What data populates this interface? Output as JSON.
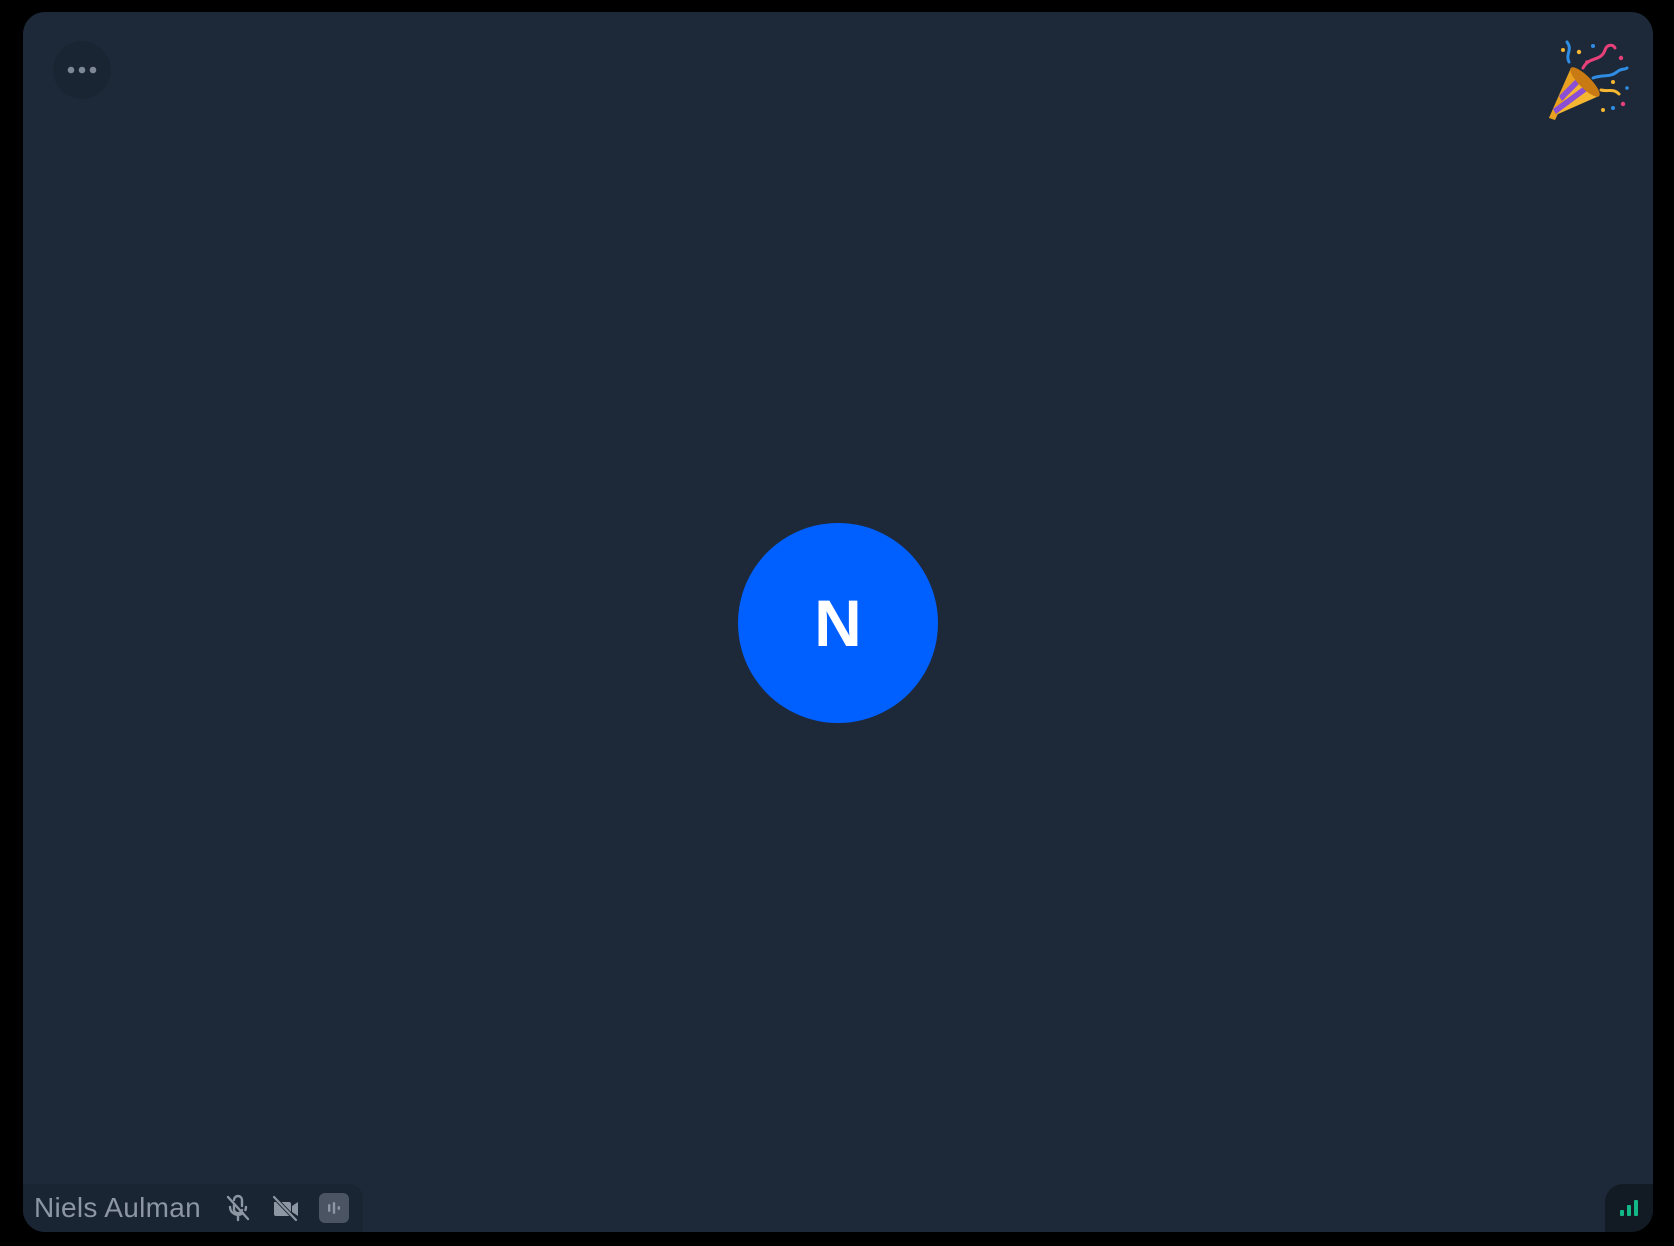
{
  "participant": {
    "name": "Niels Aulman",
    "initial": "N",
    "avatar_color": "#0060ff",
    "microphone": "muted",
    "camera": "off",
    "audio_level": "silent"
  },
  "tile": {
    "background_color": "#1d2939",
    "menu_icon": "more-horizontal-icon",
    "reaction_icon": "party-popper-icon",
    "reaction": "🎉",
    "network_quality": "good",
    "network_color": "#12b886"
  },
  "icons": {
    "mic": "mic-off-icon",
    "camera": "video-off-icon",
    "audio": "audio-level-icon",
    "network": "network-signal-icon"
  }
}
